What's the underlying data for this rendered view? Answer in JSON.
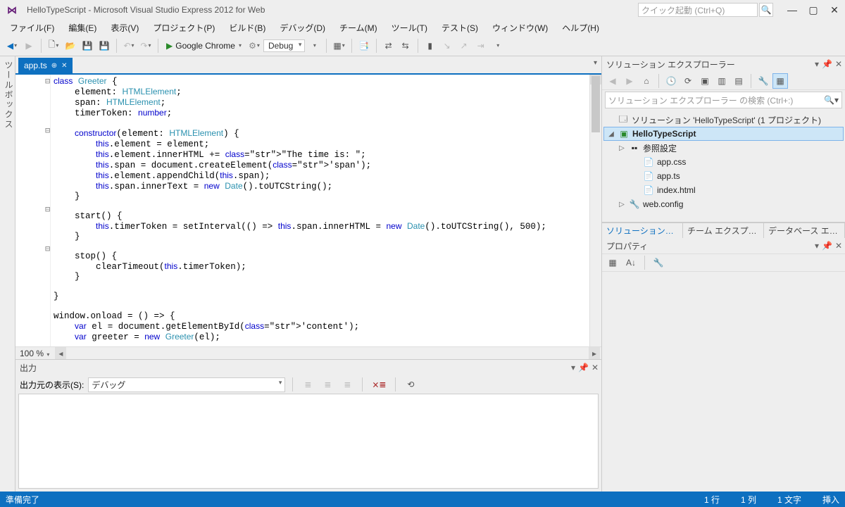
{
  "title": "HelloTypeScript - Microsoft Visual Studio Express 2012 for Web",
  "quick_launch_placeholder": "クイック起動 (Ctrl+Q)",
  "menu": [
    "ファイル(F)",
    "編集(E)",
    "表示(V)",
    "プロジェクト(P)",
    "ビルド(B)",
    "デバッグ(D)",
    "チーム(M)",
    "ツール(T)",
    "テスト(S)",
    "ウィンドウ(W)",
    "ヘルプ(H)"
  ],
  "run_target": "Google Chrome",
  "config": "Debug",
  "doc_tab": "app.ts",
  "toolbox_label": "ツールボックス",
  "zoom": "100 %",
  "code_lines": [
    {
      "t": "class Greeter {",
      "o": "⊟"
    },
    {
      "t": "    element: HTMLElement;"
    },
    {
      "t": "    span: HTMLElement;"
    },
    {
      "t": "    timerToken: number;"
    },
    {
      "t": ""
    },
    {
      "t": "    constructor(element: HTMLElement) {",
      "o": "⊟"
    },
    {
      "t": "        this.element = element;"
    },
    {
      "t": "        this.element.innerHTML += \"The time is: \";"
    },
    {
      "t": "        this.span = document.createElement('span');"
    },
    {
      "t": "        this.element.appendChild(this.span);"
    },
    {
      "t": "        this.span.innerText = new Date().toUTCString();"
    },
    {
      "t": "    }"
    },
    {
      "t": ""
    },
    {
      "t": "    start() {",
      "o": "⊟"
    },
    {
      "t": "        this.timerToken = setInterval(() => this.span.innerHTML = new Date().toUTCString(), 500);"
    },
    {
      "t": "    }"
    },
    {
      "t": ""
    },
    {
      "t": "    stop() {",
      "o": "⊟"
    },
    {
      "t": "        clearTimeout(this.timerToken);"
    },
    {
      "t": "    }"
    },
    {
      "t": ""
    },
    {
      "t": "}"
    },
    {
      "t": ""
    },
    {
      "t": "window.onload = () => {"
    },
    {
      "t": "    var el = document.getElementById('content');"
    },
    {
      "t": "    var greeter = new Greeter(el);"
    }
  ],
  "output": {
    "title": "出力",
    "source_label": "出力元の表示(S):",
    "source_value": "デバッグ"
  },
  "solution_explorer": {
    "title": "ソリューション エクスプローラー",
    "search_placeholder": "ソリューション エクスプローラー の検索 (Ctrl+:)",
    "solution": "ソリューション 'HelloTypeScript' (1 プロジェクト)",
    "project": "HelloTypeScript",
    "nodes": [
      {
        "label": "参照設定",
        "icon": "▪▪"
      },
      {
        "label": "app.css",
        "icon": "📄"
      },
      {
        "label": "app.ts",
        "icon": "📄"
      },
      {
        "label": "index.html",
        "icon": "📄"
      },
      {
        "label": "web.config",
        "icon": "🔧"
      }
    ],
    "tabs": [
      "ソリューション…",
      "チーム エクスプ…",
      "データベース エ…"
    ]
  },
  "properties": {
    "title": "プロパティ"
  },
  "status": {
    "ready": "準備完了",
    "line": "1 行",
    "col": "1 列",
    "ch": "1 文字",
    "ins": "挿入"
  }
}
